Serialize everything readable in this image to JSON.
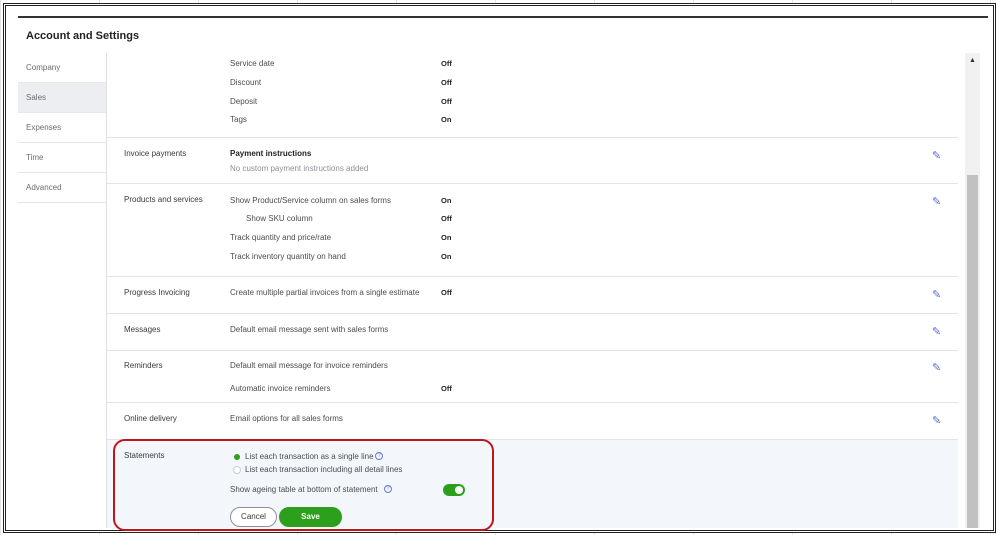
{
  "title": "Account and Settings",
  "sidebar": [
    "Company",
    "Sales",
    "Expenses",
    "Time",
    "Advanced"
  ],
  "top_items": [
    {
      "label": "Service date",
      "value": "Off"
    },
    {
      "label": "Discount",
      "value": "Off"
    },
    {
      "label": "Deposit",
      "value": "Off"
    },
    {
      "label": "Tags",
      "value": "On"
    }
  ],
  "invoice_payments": {
    "label": "Invoice payments",
    "heading": "Payment instructions",
    "sub": "No custom payment instructions added"
  },
  "products": {
    "label": "Products and services",
    "items": [
      {
        "label": "Show Product/Service column on sales forms",
        "value": "On"
      },
      {
        "label": "Show SKU column",
        "value": "Off"
      },
      {
        "label": "Track quantity and price/rate",
        "value": "On"
      },
      {
        "label": "Track inventory quantity on hand",
        "value": "On"
      }
    ]
  },
  "progress": {
    "label": "Progress Invoicing",
    "text": "Create multiple partial invoices from a single estimate",
    "value": "Off"
  },
  "messages": {
    "label": "Messages",
    "text": "Default email message sent with sales forms"
  },
  "reminders": {
    "label": "Reminders",
    "text": "Default email message for invoice reminders",
    "auto": "Automatic invoice reminders",
    "value": "Off"
  },
  "online": {
    "label": "Online delivery",
    "text": "Email options for all sales forms"
  },
  "statements": {
    "label": "Statements",
    "option1": "List each transaction as a single line",
    "option2": "List each transaction including all detail lines",
    "ageing": "Show ageing table at bottom of statement",
    "help": "?",
    "cancel": "Cancel",
    "save": "Save"
  },
  "colors": {
    "accent": "#2ca01c",
    "highlight": "#c0151b"
  }
}
